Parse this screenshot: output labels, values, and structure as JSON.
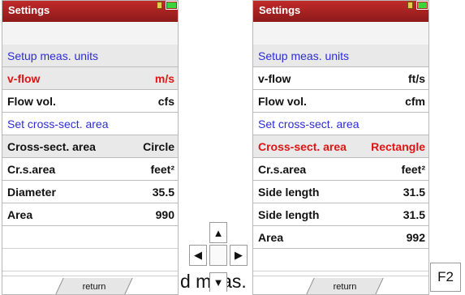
{
  "left_screen": {
    "title": "Settings",
    "rows": [
      {
        "label": "Setup meas. units",
        "value": "",
        "style": "header"
      },
      {
        "label": "v-flow",
        "value": "m/s",
        "style": "active"
      },
      {
        "label": "Flow vol.",
        "value": "cfs",
        "style": "normal"
      },
      {
        "label": "Set cross-sect. area",
        "value": "",
        "style": "header"
      },
      {
        "label": "Cross-sect. area",
        "value": "Circle",
        "style": "normal"
      },
      {
        "label": "Cr.s.area",
        "value": "feet²",
        "style": "normal"
      },
      {
        "label": "Diameter",
        "value": "35.5",
        "style": "normal"
      },
      {
        "label": "Area",
        "value": "990",
        "style": "normal"
      }
    ],
    "softkey": "return"
  },
  "right_screen": {
    "title": "Settings",
    "rows": [
      {
        "label": "Setup meas. units",
        "value": "",
        "style": "header"
      },
      {
        "label": "v-flow",
        "value": "ft/s",
        "style": "normal"
      },
      {
        "label": "Flow vol.",
        "value": "cfm",
        "style": "normal"
      },
      {
        "label": "Set cross-sect. area",
        "value": "",
        "style": "header"
      },
      {
        "label": "Cross-sect. area",
        "value": "Rectangle",
        "style": "active"
      },
      {
        "label": "Cr.s.area",
        "value": "feet²",
        "style": "normal"
      },
      {
        "label": "Side length",
        "value": "31.5",
        "style": "normal"
      },
      {
        "label": "Side length",
        "value": "31.5",
        "style": "normal"
      },
      {
        "label": "Area",
        "value": "992",
        "style": "normal"
      }
    ],
    "softkey": "return"
  },
  "keypad": {
    "up": "▲",
    "down": "▼",
    "left": "◀",
    "right": "▶"
  },
  "function_key": "F2",
  "overlay_text": "d meas."
}
